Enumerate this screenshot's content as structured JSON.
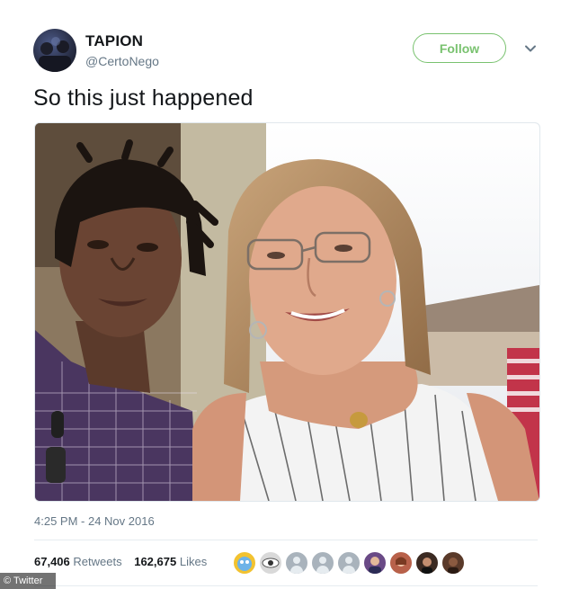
{
  "tweet": {
    "display_name": "TAPION",
    "handle": "@CertoNego",
    "follow_label": "Follow",
    "text": "So this just happened",
    "timestamp": "4:25 PM - 24 Nov 2016"
  },
  "stats": {
    "retweets_count": "67,406",
    "retweets_label": "Retweets",
    "likes_count": "162,675",
    "likes_label": "Likes"
  },
  "likers": [
    {
      "icon": "liker-avatar-cartoon",
      "color": "#f2c230"
    },
    {
      "icon": "liker-avatar-eye",
      "color": "#d9d9d9"
    },
    {
      "icon": "liker-avatar-default",
      "color": "#a9b3bc"
    },
    {
      "icon": "liker-avatar-default",
      "color": "#a9b3bc"
    },
    {
      "icon": "liker-avatar-default",
      "color": "#a9b3bc"
    },
    {
      "icon": "liker-avatar-person",
      "color": "#6a4a86"
    },
    {
      "icon": "liker-avatar-person",
      "color": "#b8614a"
    },
    {
      "icon": "liker-avatar-person",
      "color": "#3b2a22"
    },
    {
      "icon": "liker-avatar-person",
      "color": "#5a3a2a"
    }
  ],
  "credit": "© Twitter",
  "colors": {
    "follow_green": "#79c26f",
    "text": "#14171a",
    "secondary": "#657786",
    "divider": "#e6ecf0"
  }
}
